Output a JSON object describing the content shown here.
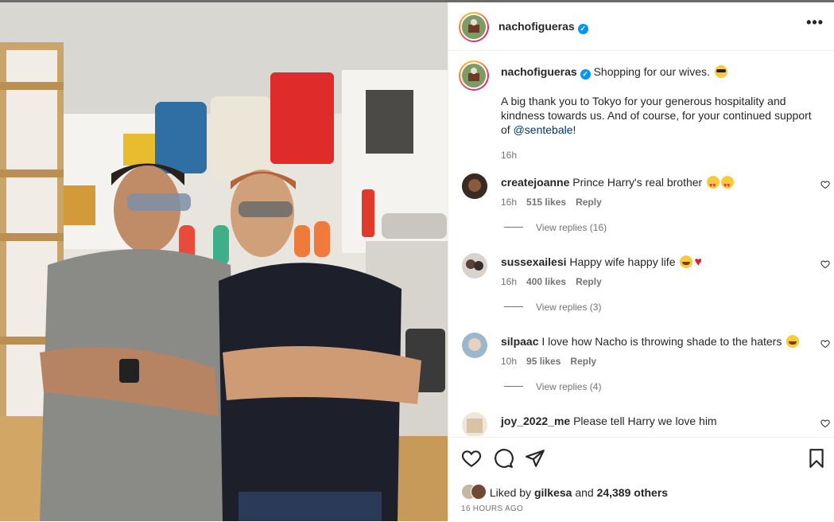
{
  "post": {
    "author": "nachofigueras",
    "more_icon": "more-horizontal-icon",
    "caption_line1": "Shopping for our wives.",
    "caption_emoji": "sunglasses-face-emoji",
    "caption_line2_pre": "A big thank you to Tokyo for your generous hospitality and kindness towards us. And of course, for your continued support of",
    "caption_mention": "@sentebale",
    "caption_line2_post": "!",
    "caption_time": "16h"
  },
  "comments": [
    {
      "user": "createjoanne",
      "text": "Prince Harry's real brother",
      "emoji": "heart-eyes-emoji x2",
      "time": "16h",
      "likes": "515 likes",
      "reply": "Reply",
      "view_replies": "View replies (16)"
    },
    {
      "user": "sussexailesi",
      "text": "Happy wife happy life",
      "emoji": "laughing-emoji, red-heart-emoji",
      "time": "16h",
      "likes": "400 likes",
      "reply": "Reply",
      "view_replies": "View replies (3)"
    },
    {
      "user": "silpaac",
      "text": "I love how Nacho is throwing shade to the haters",
      "emoji": "laughing-emoji",
      "time": "10h",
      "likes": "95 likes",
      "reply": "Reply",
      "view_replies": "View replies (4)"
    },
    {
      "user": "joy_2022_me",
      "text": "Please tell Harry we love him",
      "emoji": "",
      "time": "",
      "likes": "",
      "reply": "",
      "view_replies": ""
    }
  ],
  "footer": {
    "liked_by_prefix": "Liked by",
    "liked_by_user": "gilkesa",
    "liked_by_suffix": "and",
    "liked_by_others": "24,389 others",
    "timestamp": "16 HOURS AGO"
  },
  "colors": {
    "verified": "#0095f6",
    "link": "#00376b",
    "muted": "#737373",
    "text": "#262626"
  }
}
